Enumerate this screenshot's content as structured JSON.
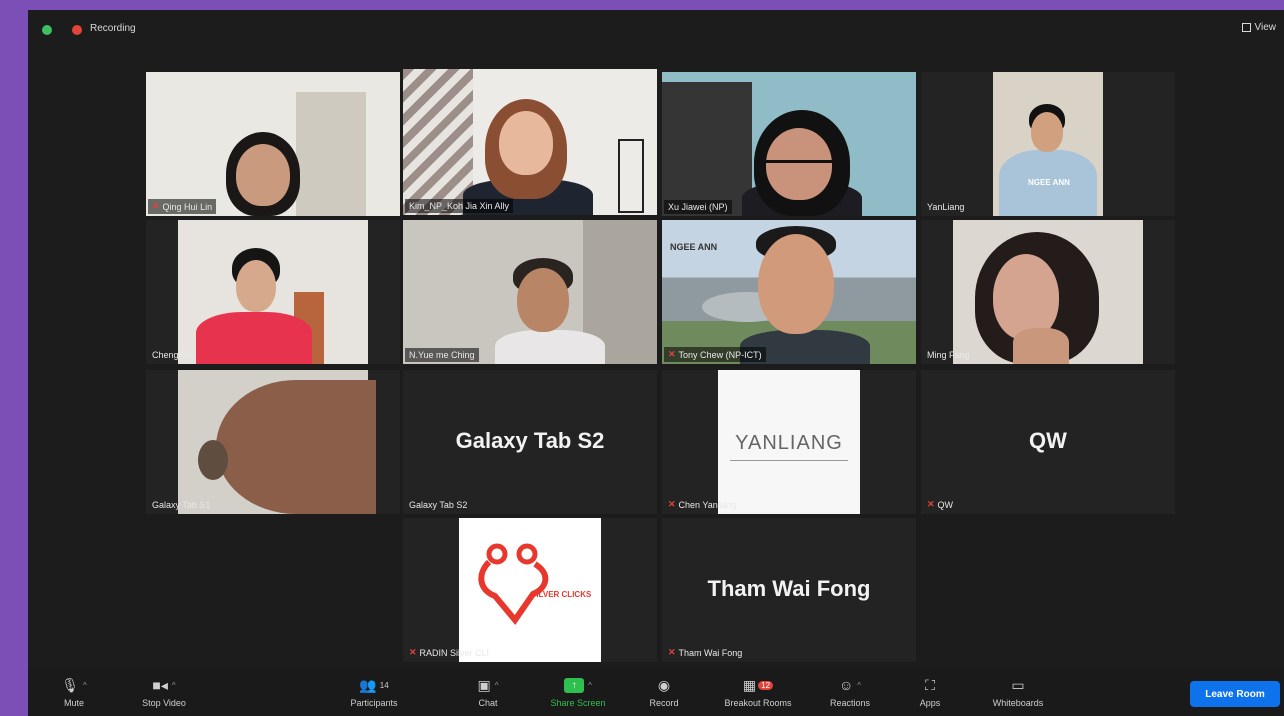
{
  "topbar": {
    "recording_label": "Recording",
    "view_label": "View"
  },
  "tiles": [
    {
      "name": "Qing Hui Lin"
    },
    {
      "name": "Kim_NP_Koh Jia Xin Ally"
    },
    {
      "name": "Xu Jiawei (NP)"
    },
    {
      "name": "YanLiang"
    },
    {
      "name": "ChengKei"
    },
    {
      "name": "N.Yue me Ching"
    },
    {
      "name": "Tony Chew (NP-ICT)"
    },
    {
      "name": "Ming Fang"
    },
    {
      "name": "Galaxy Tab S1"
    },
    {
      "name": "Galaxy Tab S2",
      "display": "Galaxy Tab S2"
    },
    {
      "name": "Chen Yanliang",
      "logo": "YANLIANG"
    },
    {
      "name": "QW",
      "display": "QW"
    },
    {
      "name": "RADIN Silver CLI",
      "logo": "SILVER CLICKS"
    },
    {
      "name": "Tham Wai Fong",
      "display": "Tham Wai Fong"
    }
  ],
  "tile_texts": {
    "ngee_ann": "NGEE ANN",
    "shirt": "NGEE ANN"
  },
  "toolbar": {
    "mute": "Mute",
    "stop_video": "Stop Video",
    "participants": "Participants",
    "participants_count": "14",
    "chat": "Chat",
    "share_screen": "Share Screen",
    "record": "Record",
    "breakout_rooms": "Breakout Rooms",
    "breakout_badge": "12",
    "reactions": "Reactions",
    "apps": "Apps",
    "whiteboards": "Whiteboards",
    "leave": "Leave Room"
  },
  "colors": {
    "accent_blue": "#0e72ed",
    "share_green": "#2fbf4f",
    "frame_purple": "#7b4fb5",
    "active_speaker": "#c7d66a"
  }
}
